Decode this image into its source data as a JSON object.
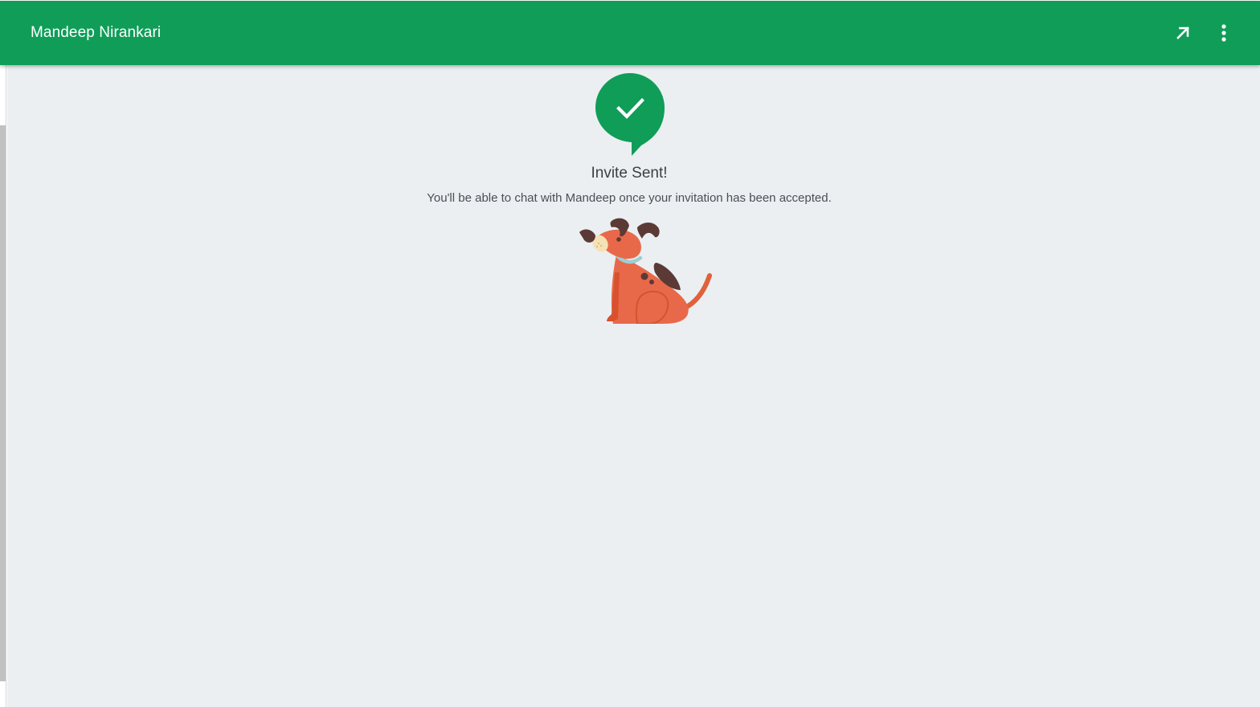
{
  "header": {
    "title": "Mandeep Nirankari",
    "background_color": "#0f9d58",
    "buttons": [
      {
        "name": "popout-icon"
      },
      {
        "name": "more-vert-icon"
      }
    ]
  },
  "main": {
    "background_color": "#ebeff2",
    "badge_icon": "check-speech-bubble-icon",
    "title": "Invite Sent!",
    "message": "You'll be able to chat with Mandeep once your invitation has been accepted.",
    "illustration": "sitting-dog-illustration"
  }
}
